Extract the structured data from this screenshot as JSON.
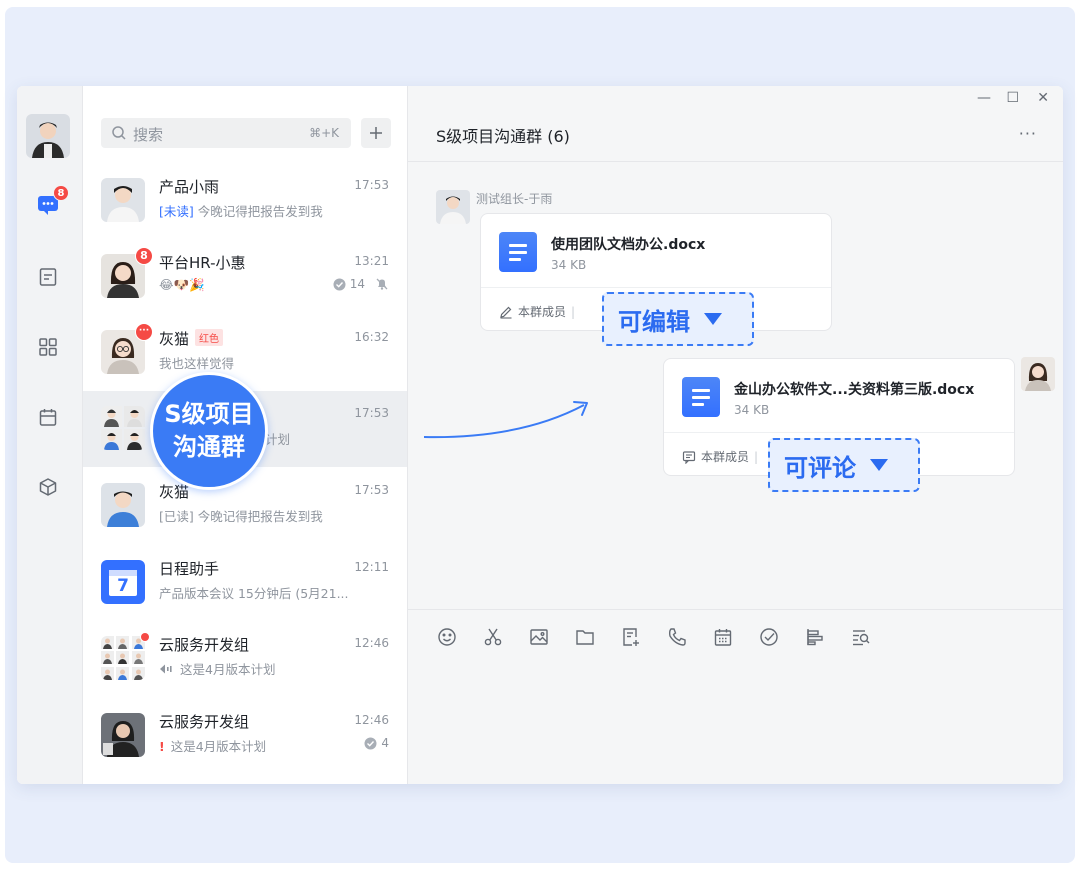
{
  "search": {
    "placeholder": "搜索",
    "shortcut": "⌘+K"
  },
  "rail": {
    "chat_badge": "8"
  },
  "conversations": [
    {
      "name": "产品小雨",
      "time": "17:53",
      "preview_tag": "[未读]",
      "preview": "今晚记得把报告发到我"
    },
    {
      "name": "平台HR-小惠",
      "time": "13:21",
      "badge": "8",
      "preview": "😂🐶🎉",
      "count": "14"
    },
    {
      "name": "灰猫",
      "tag": "红色",
      "time": "16:32",
      "badge": "···",
      "preview": "我也这样觉得"
    },
    {
      "name": "S级项目沟通群",
      "time": "17:53",
      "preview": "计划"
    },
    {
      "name": "灰猫",
      "time": "17:53",
      "preview": "[已读] 今晚记得把报告发到我"
    },
    {
      "name": "日程助手",
      "time": "12:11",
      "icon_day": "7",
      "preview": "产品版本会议 15分钟后 (5月21..."
    },
    {
      "name": "云服务开发组",
      "time": "12:46",
      "preview": "这是4月版本计划"
    },
    {
      "name": "云服务开发组",
      "time": "12:46",
      "alert": "!",
      "preview": "这是4月版本计划",
      "count": "4"
    }
  ],
  "overlay": {
    "bubble_line1": "S级项目",
    "bubble_line2": "沟通群"
  },
  "chat": {
    "title": "S级项目沟通群 (6)",
    "sender": "测试组长-于雨",
    "card1": {
      "name": "使用团队文档办公.docx",
      "size": "34 KB",
      "scope": "本群成员",
      "permission": "可编辑"
    },
    "card2": {
      "name": "金山办公软件文...关资料第三版.docx",
      "size": "34 KB",
      "scope": "本群成员",
      "permission": "可评论"
    }
  },
  "window": {
    "minimize": "—",
    "maximize": "☐",
    "close": "✕",
    "more": "···"
  },
  "colors": {
    "accent": "#3370ff",
    "badge": "#f54a45",
    "callout": "#3a7bf5"
  }
}
